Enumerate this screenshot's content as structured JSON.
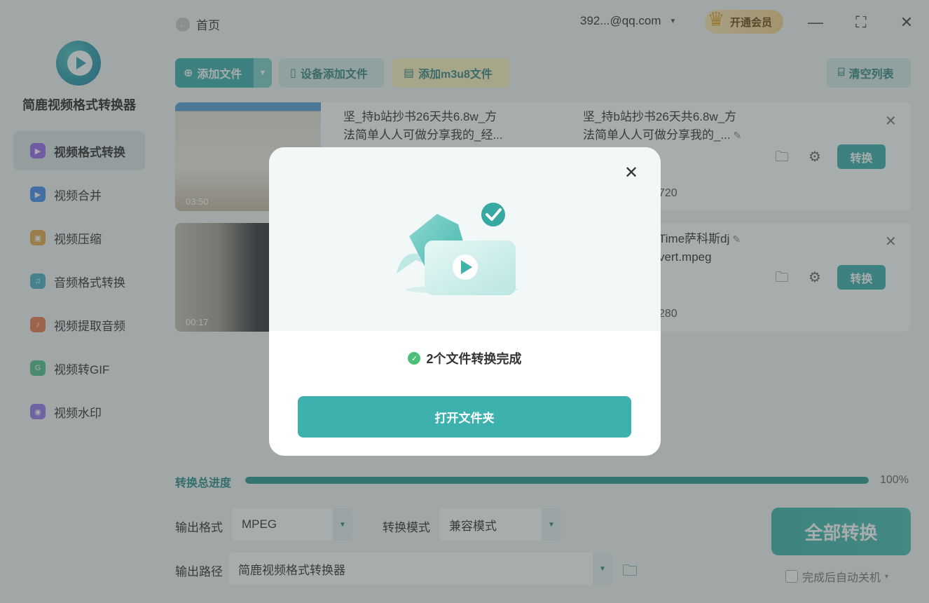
{
  "app": {
    "name": "简鹿视频格式转换器"
  },
  "sidebar": {
    "items": [
      {
        "label": "视频格式转换",
        "color": "#9b6bf0"
      },
      {
        "label": "视频合并",
        "color": "#4a8ff0"
      },
      {
        "label": "视频压缩",
        "color": "#e8a94a"
      },
      {
        "label": "音频格式转换",
        "color": "#4fb3c9"
      },
      {
        "label": "视频提取音频",
        "color": "#ea7d4f"
      },
      {
        "label": "视频转GIF",
        "color": "#58c48d"
      },
      {
        "label": "视频水印",
        "color": "#9a7cef"
      }
    ]
  },
  "header": {
    "back_label": "首页",
    "account": "392...@qq.com",
    "vip_label": "开通会员"
  },
  "toolbar": {
    "add_file": "添加文件",
    "device_add": "设备添加文件",
    "add_m3u8": "添加m3u8文件",
    "clear_list": "清空列表"
  },
  "files": [
    {
      "duration": "03:50",
      "source_name": "坚_持b站抄书26天共6.8w_方法简单人人可做分享我的_经...",
      "output_name": "坚_持b站抄书26天共6.8w_方法简单人人可做分享我的_...",
      "resolution_suffix": "720",
      "convert_label": "转换"
    },
    {
      "duration": "00:17",
      "output_name": "Time萨科斯dj",
      "output_name2": "vert.mpeg",
      "resolution_suffix": "280",
      "convert_label": "转换"
    }
  ],
  "progress": {
    "label": "转换总进度",
    "value": 100,
    "text": "100%"
  },
  "settings": {
    "format_label": "输出格式",
    "format_value": "MPEG",
    "mode_label": "转换模式",
    "mode_value": "兼容模式",
    "path_label": "输出路径",
    "path_value": "简鹿视频格式转换器",
    "convert_all": "全部转换",
    "shutdown_label": "完成后自动关机"
  },
  "modal": {
    "message": "2个文件转换完成",
    "open_folder": "打开文件夹"
  },
  "colors": {
    "accent": "#3cb1ad",
    "success": "#4cc07a"
  }
}
